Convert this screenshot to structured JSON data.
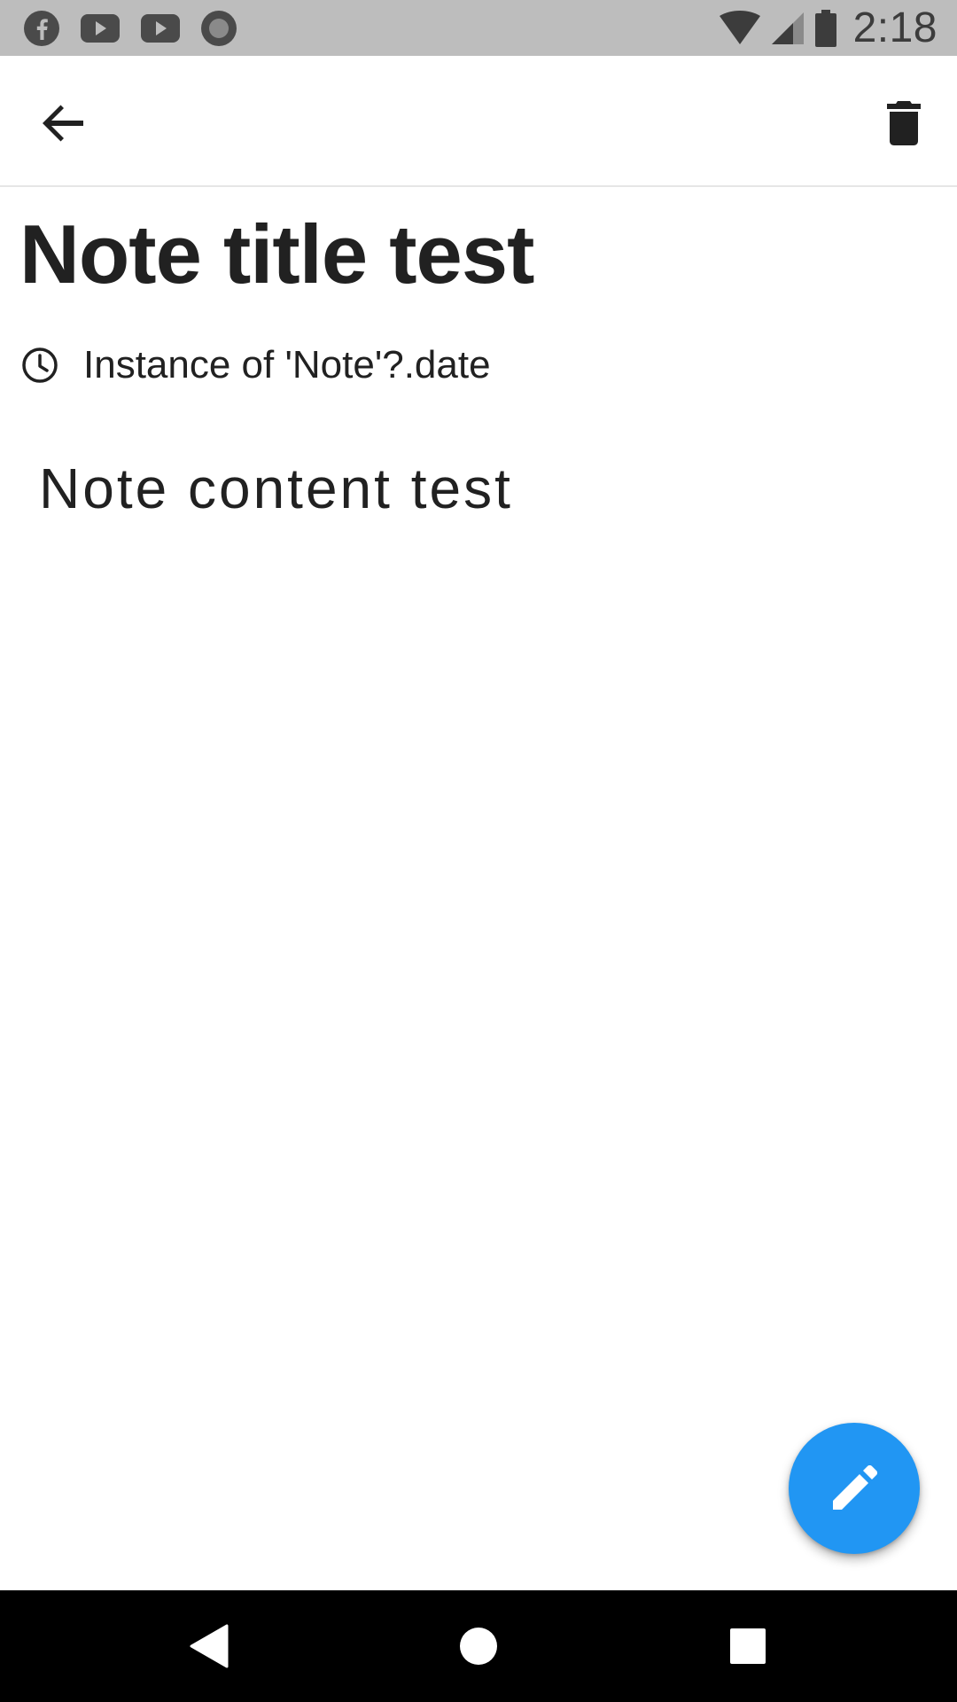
{
  "status_bar": {
    "time": "2:18",
    "left_icons": [
      "facebook-icon",
      "youtube-icon",
      "youtube-icon",
      "record-icon"
    ],
    "right_icons": [
      "wifi-icon",
      "signal-icon",
      "battery-icon"
    ],
    "background": "#bdbdbd"
  },
  "app_bar": {
    "back_icon": "arrow-back-icon",
    "delete_icon": "trash-icon"
  },
  "note": {
    "title": "Note title test",
    "date_icon": "clock-icon",
    "date": "Instance of 'Note'?.date",
    "content": "Note content test"
  },
  "fab": {
    "icon": "pencil-icon",
    "color": "#2196f3"
  },
  "nav_bar": {
    "icons": [
      "nav-back-icon",
      "nav-home-icon",
      "nav-recents-icon"
    ]
  }
}
